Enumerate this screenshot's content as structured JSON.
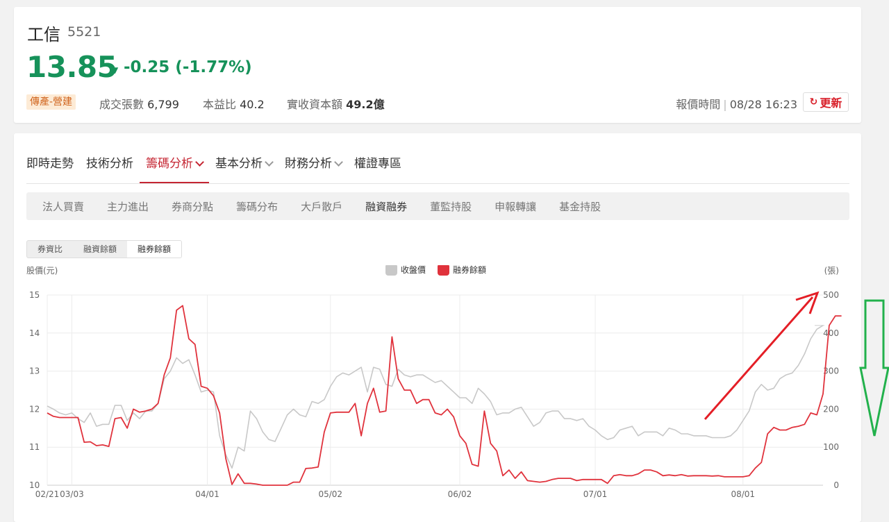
{
  "stock": {
    "name": "工信",
    "code": "5521",
    "price": "13.85",
    "change": "-0.25 (-1.77%)",
    "sector": "傳產-營建",
    "volume_label": "成交張數",
    "volume": "6,799",
    "pe_label": "本益比",
    "pe": "40.2",
    "capital_label": "實收資本額",
    "capital": "49.2億",
    "quote_time_label": "報價時間",
    "quote_time": "08/28 16:23",
    "refresh_label": "更新",
    "up_color": "#d81d27",
    "down_color": "#16925a"
  },
  "main_tabs": [
    {
      "label": "即時走勢",
      "dropdown": false,
      "active": false
    },
    {
      "label": "技術分析",
      "dropdown": false,
      "active": false
    },
    {
      "label": "籌碼分析",
      "dropdown": true,
      "active": true
    },
    {
      "label": "基本分析",
      "dropdown": true,
      "active": false
    },
    {
      "label": "財務分析",
      "dropdown": true,
      "active": false
    },
    {
      "label": "權證專區",
      "dropdown": false,
      "active": false
    }
  ],
  "sub_tabs": [
    "法人買賣",
    "主力進出",
    "券商分點",
    "籌碼分布",
    "大戶散戶",
    "融資融券",
    "董監持股",
    "申報轉讓",
    "基金持股"
  ],
  "sub_tab_active": 5,
  "segments": [
    "券資比",
    "融資餘額",
    "融券餘額"
  ],
  "segment_active": 2,
  "chart_data": {
    "type": "line",
    "left_axis_label": "股價(元)",
    "right_axis_label": "(張)",
    "x_tick_labels": [
      "02/21",
      "03/03",
      "04/01",
      "05/02",
      "06/02",
      "07/01",
      "08/01"
    ],
    "x_ticks_index": [
      0,
      4,
      26,
      46,
      67,
      89,
      113
    ],
    "y_left": {
      "range": [
        10,
        15
      ],
      "ticks": [
        10,
        11,
        12,
        13,
        14,
        15
      ]
    },
    "y_right": {
      "range": [
        0,
        500
      ],
      "ticks": [
        0,
        100,
        200,
        300,
        400,
        500
      ]
    },
    "series": [
      {
        "name": "收盤價",
        "axis": "left",
        "color": "#c8c8c8",
        "values": [
          12.08,
          12.0,
          11.9,
          11.85,
          11.9,
          11.75,
          11.65,
          11.9,
          11.55,
          11.6,
          11.6,
          12.1,
          12.1,
          11.7,
          11.9,
          11.75,
          11.95,
          11.95,
          12.15,
          12.8,
          13.0,
          13.35,
          13.2,
          13.3,
          12.9,
          12.45,
          12.5,
          12.45,
          11.3,
          10.8,
          10.45,
          11.0,
          10.9,
          11.95,
          11.75,
          11.4,
          11.2,
          11.15,
          11.5,
          11.85,
          12.0,
          11.85,
          11.8,
          12.2,
          12.15,
          12.25,
          12.6,
          12.85,
          12.95,
          12.9,
          13.0,
          13.1,
          12.45,
          13.1,
          13.05,
          12.65,
          12.6,
          13.05,
          12.9,
          12.85,
          12.9,
          12.9,
          12.8,
          12.7,
          12.75,
          12.6,
          12.45,
          12.3,
          12.3,
          12.15,
          12.55,
          12.4,
          12.2,
          11.85,
          11.9,
          11.9,
          12.0,
          12.05,
          11.8,
          11.55,
          11.65,
          11.9,
          11.95,
          11.95,
          11.75,
          11.75,
          11.7,
          11.75,
          11.55,
          11.45,
          11.3,
          11.2,
          11.25,
          11.45,
          11.5,
          11.55,
          11.3,
          11.4,
          11.4,
          11.4,
          11.3,
          11.5,
          11.45,
          11.35,
          11.35,
          11.3,
          11.3,
          11.3,
          11.25,
          11.25,
          11.25,
          11.3,
          11.45,
          11.7,
          11.95,
          12.45,
          12.65,
          12.5,
          12.55,
          12.8,
          12.9,
          12.95,
          13.15,
          13.45,
          13.85,
          14.1,
          14.2
        ]
      },
      {
        "name": "融券餘額",
        "axis": "right",
        "color": "#e0323c",
        "values": [
          190,
          181,
          178,
          178,
          178,
          178,
          113,
          114,
          104,
          106,
          102,
          175,
          178,
          150,
          200,
          192,
          195,
          200,
          215,
          290,
          335,
          460,
          472,
          385,
          370,
          260,
          255,
          235,
          190,
          70,
          2,
          30,
          5,
          5,
          3,
          0,
          0,
          0,
          0,
          0,
          8,
          8,
          44,
          45,
          48,
          140,
          190,
          192,
          192,
          192,
          215,
          130,
          215,
          255,
          192,
          195,
          390,
          280,
          250,
          250,
          215,
          225,
          225,
          190,
          185,
          200,
          180,
          130,
          110,
          55,
          50,
          195,
          110,
          90,
          25,
          40,
          18,
          35,
          12,
          10,
          8,
          10,
          15,
          18,
          18,
          18,
          12,
          15,
          15,
          15,
          15,
          5,
          25,
          28,
          25,
          25,
          30,
          40,
          40,
          35,
          25,
          27,
          25,
          28,
          24,
          25,
          25,
          25,
          24,
          25,
          22,
          22,
          22,
          22,
          25,
          45,
          60,
          135,
          152,
          145,
          145,
          152,
          155,
          160,
          190,
          185,
          240,
          420,
          445,
          445
        ]
      }
    ]
  }
}
